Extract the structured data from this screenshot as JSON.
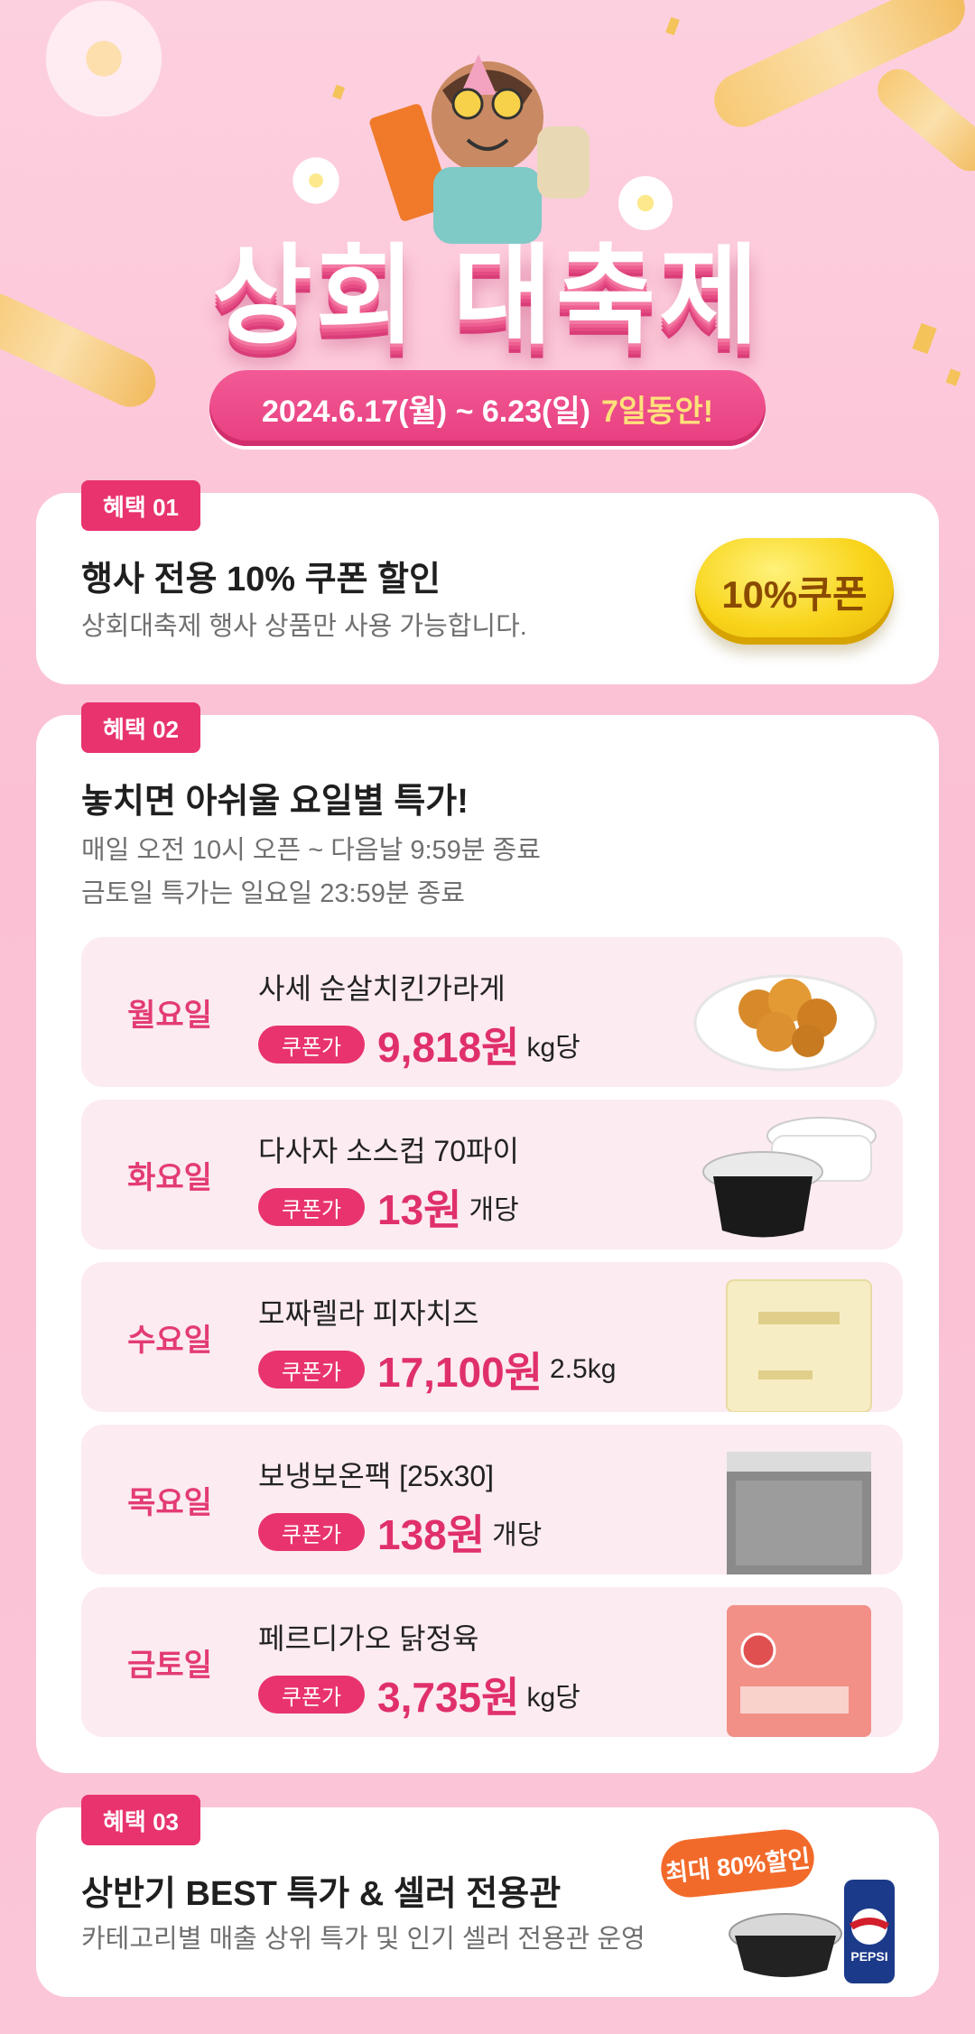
{
  "hero": {
    "title": "상회 대축제",
    "date_range": "2024.6.17(월) ~ 6.23(일)",
    "duration_highlight": "7일동안!"
  },
  "benefit1": {
    "badge": "혜택 01",
    "title": "행사 전용 10% 쿠폰 할인",
    "desc": "상회대축제 행사 상품만 사용 가능합니다.",
    "coupon_label": "10%쿠폰"
  },
  "benefit2": {
    "badge": "혜택 02",
    "title": "놓치면 아쉬울 요일별 특가!",
    "desc_line1": "매일 오전 10시 오픈 ~ 다음날 9:59분 종료",
    "desc_line2": "금토일 특가는 일요일 23:59분 종료",
    "coupon_tag": "쿠폰가",
    "days": [
      {
        "day": "월요일",
        "product": "사세 순살치킨가라게",
        "price": "9,818원",
        "unit": "kg당",
        "image": "fried-chicken"
      },
      {
        "day": "화요일",
        "product": "다사자 소스컵 70파이",
        "price": "13원",
        "unit": "개당",
        "image": "sauce-cup"
      },
      {
        "day": "수요일",
        "product": "모짜렐라 피자치즈",
        "price": "17,100원",
        "unit": "2.5kg",
        "image": "cheese-bag"
      },
      {
        "day": "목요일",
        "product": "보냉보온팩 [25x30]",
        "price": "138원",
        "unit": "개당",
        "image": "insulated-pack"
      },
      {
        "day": "금토일",
        "product": "페르디가오 닭정육",
        "price": "3,735원",
        "unit": "kg당",
        "image": "chicken-meat-bag"
      }
    ]
  },
  "benefit3": {
    "badge": "혜택 03",
    "title": "상반기 BEST 특가 & 셀러 전용관",
    "desc": "카테고리별 매출 상위 특가 및 인기 셀러 전용관 운영",
    "sale_bubble": "최대 80%할인",
    "can_brand": "PEPSI"
  },
  "colors": {
    "accent": "#e8336e",
    "background": "#fbc3d6",
    "coupon_yellow": "#f8d41a"
  }
}
